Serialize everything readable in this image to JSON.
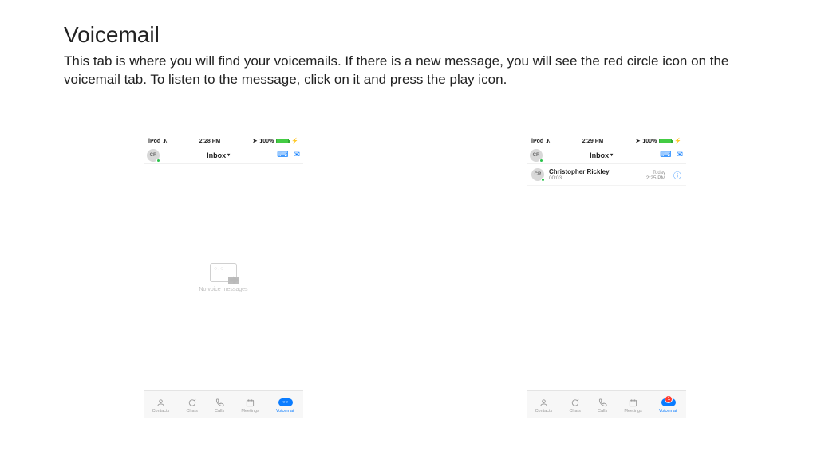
{
  "page": {
    "title": "Voicemail",
    "description": "This tab is where you will find your voicemails.  If there is a new message, you will see the red circle icon on the voicemail tab.  To listen to the message, click on it and press the play icon."
  },
  "left": {
    "status": {
      "carrier": "iPod",
      "time": "2:28 PM",
      "battery": "100%"
    },
    "header": {
      "avatar_initials": "CR",
      "title": "Inbox",
      "caret": "▾"
    },
    "empty_text": "No voice messages",
    "tabs": {
      "contacts": "Contacts",
      "chats": "Chats",
      "calls": "Calls",
      "meetings": "Meetings",
      "voicemail": "Voicemail"
    }
  },
  "right": {
    "status": {
      "carrier": "iPod",
      "time": "2:29 PM",
      "battery": "100%"
    },
    "header": {
      "avatar_initials": "CR",
      "title": "Inbox",
      "caret": "▾"
    },
    "message": {
      "avatar_initials": "CR",
      "name": "Christopher Rickley",
      "day": "Today",
      "duration": "00:03",
      "time": "2:25 PM"
    },
    "tabs": {
      "contacts": "Contacts",
      "chats": "Chats",
      "calls": "Calls",
      "meetings": "Meetings",
      "voicemail": "Voicemail",
      "badge": "1"
    }
  }
}
